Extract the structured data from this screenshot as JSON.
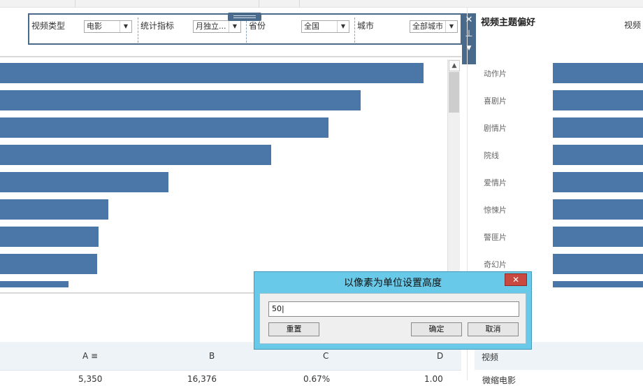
{
  "filters": {
    "video_type": {
      "label": "视频类型",
      "value": "电影"
    },
    "metric": {
      "label": "统计指标",
      "value": "月独立..."
    },
    "province": {
      "label": "省份",
      "value": "全国"
    },
    "city": {
      "label": "城市",
      "value": "全部城市"
    }
  },
  "right_panel": {
    "title": "视频主题偏好",
    "title_cut": "视频",
    "categories": [
      "动作片",
      "喜剧片",
      "剧情片",
      "院线",
      "爱情片",
      "惊悚片",
      "警匪片",
      "奇幻片"
    ]
  },
  "left_chart": {
    "bar_levels": [
      1.0,
      0.852,
      0.776,
      0.641,
      0.398,
      0.256,
      0.233,
      0.229,
      0.161
    ]
  },
  "table": {
    "headers": [
      "A",
      "B",
      "C",
      "D"
    ],
    "first_row": [
      "5,350",
      "16,376",
      "0.67%",
      "1.00"
    ],
    "right_header": "视频",
    "right_first_row": "微缩电影"
  },
  "dialog": {
    "title": "以像素为单位设置高度",
    "close_glyph": "✕",
    "value": "50",
    "reset_label": "重置",
    "ok_label": "确定",
    "cancel_label": "取消"
  }
}
